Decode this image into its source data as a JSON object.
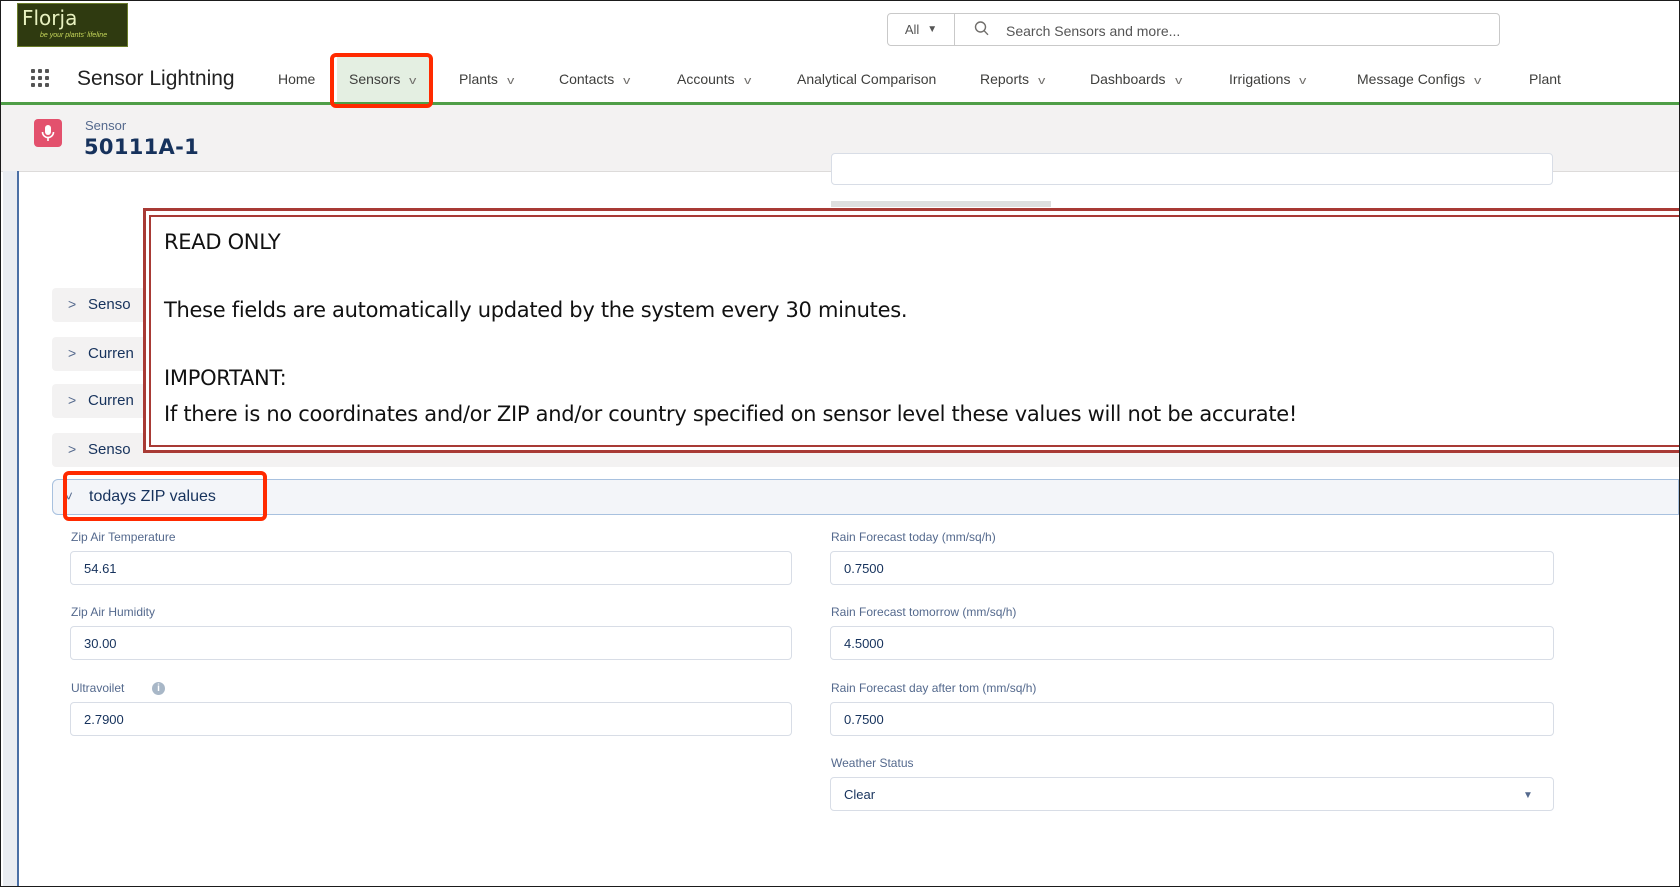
{
  "brand": {
    "logo_text": "Florja",
    "logo_tagline": "be your plants' lifeline"
  },
  "search": {
    "scope": "All",
    "placeholder": "Search Sensors and more..."
  },
  "nav": {
    "app_name": "Sensor Lightning",
    "items": [
      {
        "label": "Home",
        "has_menu": false
      },
      {
        "label": "Sensors",
        "has_menu": true,
        "active": true
      },
      {
        "label": "Plants",
        "has_menu": true
      },
      {
        "label": "Contacts",
        "has_menu": true
      },
      {
        "label": "Accounts",
        "has_menu": true
      },
      {
        "label": "Analytical Comparison",
        "has_menu": false
      },
      {
        "label": "Reports",
        "has_menu": true
      },
      {
        "label": "Dashboards",
        "has_menu": true
      },
      {
        "label": "Irrigations",
        "has_menu": true
      },
      {
        "label": "Message Configs",
        "has_menu": true
      },
      {
        "label": "Plant",
        "has_menu": false
      }
    ]
  },
  "record": {
    "type": "Sensor",
    "name": "50111A-1"
  },
  "sections": {
    "collapsed": [
      "Senso",
      "Curren",
      "Curren",
      "Senso"
    ],
    "open": "todays ZIP values"
  },
  "fields": {
    "zip_air_temperature": {
      "label": "Zip Air Temperature",
      "value": "54.61"
    },
    "zip_air_humidity": {
      "label": "Zip Air Humidity",
      "value": "30.00"
    },
    "ultraviolet": {
      "label": "Ultravoilet",
      "value": "2.7900"
    },
    "rain_today": {
      "label": "Rain Forecast today (mm/sq/h)",
      "value": "0.7500"
    },
    "rain_tomorrow": {
      "label": "Rain Forecast tomorrow (mm/sq/h)",
      "value": "4.5000"
    },
    "rain_day_after": {
      "label": "Rain Forecast day after tom (mm/sq/h)",
      "value": "0.7500"
    },
    "weather_status": {
      "label": "Weather Status",
      "value": "Clear"
    }
  },
  "callout": {
    "line1": "READ ONLY",
    "line2": "These fields are automatically updated by the system every 30 minutes.",
    "line3": "IMPORTANT:",
    "line4": "If there is no coordinates and/or ZIP and/or country specified on sensor level these values will not be accurate!"
  },
  "colors": {
    "nav_accent": "#4f9e47",
    "highlight": "#ff2a00",
    "callout_border": "#a83a35",
    "record_icon": "#e3516d"
  },
  "icons": {
    "search": "search-icon",
    "launcher": "app-launcher-icon",
    "record": "microphone-icon",
    "info": "info-icon"
  }
}
